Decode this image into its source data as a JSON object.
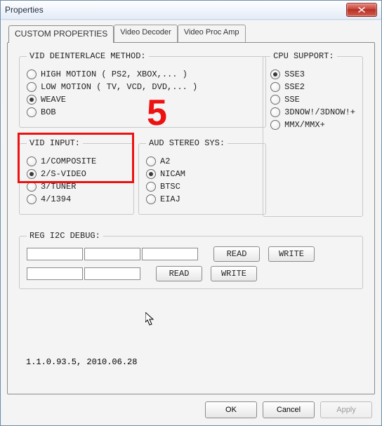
{
  "window": {
    "title": "Properties"
  },
  "tabs": {
    "custom": "CUSTOM PROPERTIES",
    "decoder": "Video Decoder",
    "procamp": "Video Proc Amp"
  },
  "groups": {
    "deint": {
      "legend": "VID DEINTERLACE METHOD:",
      "options": [
        "HIGH MOTION ( PS2, XBOX,... )",
        "LOW MOTION ( TV, VCD, DVD,... )",
        "WEAVE",
        "BOB"
      ],
      "selected": 2
    },
    "cpu": {
      "legend": "CPU SUPPORT:",
      "options": [
        "SSE3",
        "SSE2",
        "SSE",
        "3DNOW!/3DNOW!+",
        "MMX/MMX+"
      ],
      "selected": 0
    },
    "vidin": {
      "legend": "VID INPUT:",
      "options": [
        "1/COMPOSITE",
        "2/S-VIDEO",
        "3/TUNER",
        "4/1394"
      ],
      "selected": 1
    },
    "aud": {
      "legend": "AUD STEREO SYS:",
      "options": [
        "A2",
        "NICAM",
        "BTSC",
        "EIAJ"
      ],
      "selected": 1
    },
    "reg": {
      "legend": "REG I2C DEBUG:",
      "readLabel": "READ",
      "writeLabel": "WRITE"
    }
  },
  "version": "1.1.0.93.5, 2010.06.28",
  "buttons": {
    "ok": "OK",
    "cancel": "Cancel",
    "apply": "Apply"
  },
  "annotation": {
    "number": "5"
  }
}
